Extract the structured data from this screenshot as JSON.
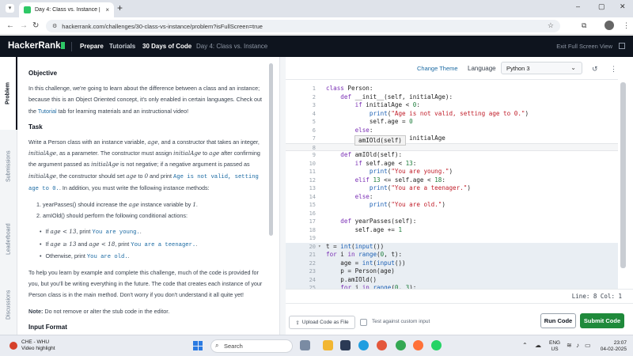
{
  "browser": {
    "tab_title": "Day 4: Class vs. Instance | Hack",
    "tab_close": "×",
    "new_tab": "+",
    "url": "hackerrank.com/challenges/30-class-vs-instance/problem?isFullScreen=true",
    "window_controls": [
      "–",
      "▢",
      "✕"
    ]
  },
  "header": {
    "logo": "HackerRank",
    "nav": [
      "Prepare",
      "Tutorials",
      "30 Days of Code"
    ],
    "breadcrumb_current": "Day 4: Class vs. Instance",
    "exit_fullscreen": "Exit Full Screen View"
  },
  "sidetabs": [
    "Problem",
    "Submissions",
    "Leaderboard",
    "Discussions"
  ],
  "problem": {
    "objective_heading": "Objective",
    "objective_text_1": "In this challenge, we're going to learn about the difference between a class and an instance; because this is an Object Oriented concept, it's only enabled in certain languages. Check out the ",
    "objective_link": "Tutorial",
    "objective_text_2": " tab for learning materials and an instructional video!",
    "task_heading": "Task",
    "task_p1_a": "Write a Person class with an instance variable, ",
    "var_age": "age",
    "task_p1_b": ", and a constructor that takes an integer, ",
    "var_initialAge": "initialAge",
    "task_p1_c": ", as a parameter. The constructor must assign ",
    "task_p1_d": " to ",
    "task_p1_e": " after confirming the argument passed as ",
    "task_p1_f": " is not negative; if a negative argument is passed as ",
    "task_p1_g": ", the constructor should set ",
    "task_p1_h": " to ",
    "zero": "0",
    "task_p1_i": " and print ",
    "msg_invalid": "Age is not valid, setting age to 0.",
    "task_p1_j": ". In addition, you must write the following instance methods:",
    "method1_a": "1. yearPasses() should increase the ",
    "method1_b": " instance variable by ",
    "one": "1",
    "method2": "2. amIOld() should perform the following conditional actions:",
    "cond1_a": "If ",
    "cond1_math": "age < 13",
    "cond1_b": ", print ",
    "msg_young": "You are young.",
    "cond2_a": "If ",
    "cond2_math": "age ≥ 13",
    "cond2_and": " and ",
    "cond2_math2": "age < 18",
    "cond2_b": ", print ",
    "msg_teen": "You are a teenager.",
    "cond3_a": "Otherwise, print ",
    "msg_old": "You are old.",
    "help_text": "To help you learn by example and complete this challenge, much of the code is provided for you, but you'll be writing everything in the future. The code that creates each instance of your Person class is in the main method. Don't worry if you don't understand it all quite yet!",
    "note_label": "Note:",
    "note_text": " Do not remove or alter the stub code in the editor.",
    "input_heading": "Input Format"
  },
  "editor": {
    "change_theme": "Change Theme",
    "language_label": "Language",
    "language_value": "Python 3",
    "autocomplete": "amIOld(self)",
    "status": "Line: 8 Col: 1",
    "upload": "Upload Code as File",
    "custom_input": "Test against custom input",
    "run": "Run Code",
    "submit": "Submit Code",
    "lines": [
      {
        "n": "1",
        "code": "class Person:"
      },
      {
        "n": "2",
        "code": "    def __init__(self, initialAge):"
      },
      {
        "n": "3",
        "code": "        if initialAge < 0:"
      },
      {
        "n": "4",
        "code": "            print(\"Age is not valid, setting age to 0.\")"
      },
      {
        "n": "5",
        "code": "            self.age = 0"
      },
      {
        "n": "6",
        "code": "        else:"
      },
      {
        "n": "7",
        "code": "            self.age = initialAge"
      },
      {
        "n": "8",
        "code": ""
      },
      {
        "n": "9",
        "code": "    def amIOld(self):"
      },
      {
        "n": "10",
        "code": "        if self.age < 13:"
      },
      {
        "n": "11",
        "code": "            print(\"You are young.\")"
      },
      {
        "n": "12",
        "code": "        elif 13 <= self.age < 18:"
      },
      {
        "n": "13",
        "code": "            print(\"You are a teenager.\")"
      },
      {
        "n": "14",
        "code": "        else:"
      },
      {
        "n": "15",
        "code": "            print(\"You are old.\")"
      },
      {
        "n": "16",
        "code": ""
      },
      {
        "n": "17",
        "code": "    def yearPasses(self):"
      },
      {
        "n": "18",
        "code": "        self.age += 1"
      },
      {
        "n": "19",
        "code": ""
      },
      {
        "n": "20",
        "code": "t = int(input())"
      },
      {
        "n": "21",
        "code": "for i in range(0, t):"
      },
      {
        "n": "22",
        "code": "    age = int(input())"
      },
      {
        "n": "23",
        "code": "    p = Person(age)"
      },
      {
        "n": "24",
        "code": "    p.amIOld()"
      },
      {
        "n": "25",
        "code": "    for j in range(0, 3):"
      }
    ]
  },
  "taskbar": {
    "weather_title": "CHE - WHU",
    "weather_sub": "Video highlight",
    "search": "Search",
    "lang_1": "ENG",
    "lang_2": "US",
    "time": "23:07",
    "date": "04-02-2025"
  },
  "colors": {
    "hr_header": "#0e141e",
    "hr_green": "#2ec866",
    "submit_green": "#1f8a3b",
    "link_blue": "#1b6aa3"
  }
}
